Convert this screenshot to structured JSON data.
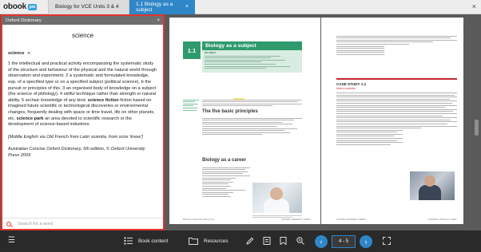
{
  "header": {
    "logo_text": "obook",
    "logo_badge": "pro",
    "book_tab": "Biology for VCE Units 3 & 4",
    "chapter_tab": "1.1 Biology as a subject",
    "close_glyph": "×",
    "tab_close_glyph": "×"
  },
  "dictionary": {
    "panel_title": "Oxford Dictionary",
    "close_glyph": "×",
    "word": "science",
    "headword": "science",
    "pos": "n.",
    "definition_1": "1 the intellectual and practical activity encompassing the systematic study of the structure and behaviour of the physical and the natural world through observation and experiment.",
    "definition_2": "2 a systematic and formulated knowledge, esp. of a specified type or on a specified subject (political science). b the pursuit or principles of this.",
    "definition_3": "3 an organised body of knowledge on a subject (the science of philology).",
    "definition_4": "4 skilful technique rather than strength or natural ability.",
    "definition_5": "5 archaic knowledge of any kind.",
    "phrase_1_term": "science fiction",
    "phrase_1_def": "fiction based on imagined future scientific or technological discoveries or environmental changes, frequently dealing with space or time travel, life on other planets, etc.",
    "phrase_2_term": "science park",
    "phrase_2_def": "an area devoted to scientific research or the development of science-based industries.",
    "etymology": "[Middle English via Old French from Latin scientia, from scire 'know']",
    "source": "Australian Concise Oxford Dictionary, 5th edition, © Oxford University Press 2009",
    "search_placeholder": "Search for a word"
  },
  "book": {
    "section_number": "1.1",
    "section_title": "Biology as a subject",
    "key_ideas_label": "KEY IDEAS",
    "principles_heading": "The five basic principles",
    "career_heading": "Biology as a career",
    "case_title": "CASE STUDY 1.1",
    "case_subtitle": "Meet a scientist",
    "footer_left": "BIOLOGY FOR VCE UNITS 3 & 4",
    "footer_mid_left": "OXFORD UNIVERSITY PRESS",
    "footer_mid_right": "OXFORD UNIVERSITY PRESS",
    "footer_right": "CHAPTER 1 BIOLOGY TODAY"
  },
  "toolbar": {
    "menu_icon": "☰",
    "book_content_label": "Book content",
    "resources_label": "Resources",
    "page_indicator": "4 - 5",
    "prev_glyph": "‹",
    "next_glyph": "›"
  }
}
